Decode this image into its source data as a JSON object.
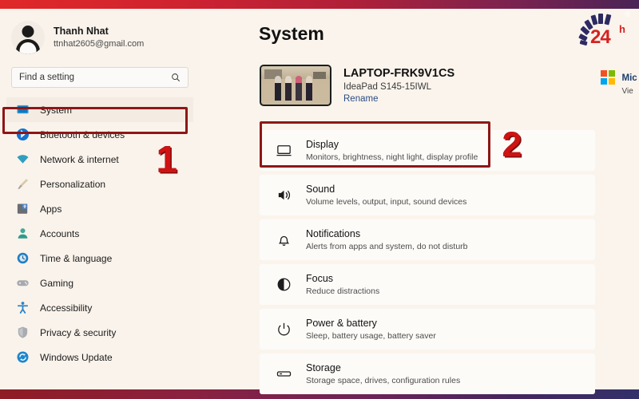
{
  "window": {
    "frame_top_color": "#cf2330",
    "frame_bottom_color": "#46265e",
    "background": "#faf4ec"
  },
  "watermark": {
    "brand": "24",
    "superscript": "h",
    "registered": "®",
    "arc_color": "#2d2a63",
    "text_color": "#d62121"
  },
  "sidebar": {
    "account": {
      "name": "Thanh Nhat",
      "email": "ttnhat2605@gmail.com",
      "avatar_icon": "person-avatar"
    },
    "search": {
      "placeholder": "Find a setting",
      "value": "",
      "icon": "search-icon"
    },
    "items": [
      {
        "label": "System",
        "icon": "monitor-icon",
        "selected": true
      },
      {
        "label": "Bluetooth & devices",
        "icon": "bluetooth-icon",
        "selected": false
      },
      {
        "label": "Network & internet",
        "icon": "wifi-icon",
        "selected": false
      },
      {
        "label": "Personalization",
        "icon": "paintbrush-icon",
        "selected": false
      },
      {
        "label": "Apps",
        "icon": "apps-icon",
        "selected": false
      },
      {
        "label": "Accounts",
        "icon": "person-icon",
        "selected": false
      },
      {
        "label": "Time & language",
        "icon": "clock-icon",
        "selected": false
      },
      {
        "label": "Gaming",
        "icon": "gamepad-icon",
        "selected": false
      },
      {
        "label": "Accessibility",
        "icon": "accessibility-icon",
        "selected": false
      },
      {
        "label": "Privacy & security",
        "icon": "shield-icon",
        "selected": false
      },
      {
        "label": "Windows Update",
        "icon": "refresh-icon",
        "selected": false
      }
    ]
  },
  "main": {
    "title": "System",
    "device": {
      "name": "LAPTOP-FRK9V1CS",
      "model": "IdeaPad S145-15IWL",
      "rename_label": "Rename",
      "thumbnail_icon": "device-photo"
    },
    "rows": [
      {
        "title": "Display",
        "sub": "Monitors, brightness, night light, display profile",
        "icon": "monitor-icon"
      },
      {
        "title": "Sound",
        "sub": "Volume levels, output, input, sound devices",
        "icon": "speaker-icon"
      },
      {
        "title": "Notifications",
        "sub": "Alerts from apps and system, do not disturb",
        "icon": "bell-icon"
      },
      {
        "title": "Focus",
        "sub": "Reduce distractions",
        "icon": "focus-icon"
      },
      {
        "title": "Power & battery",
        "sub": "Sleep, battery usage, battery saver",
        "icon": "power-icon"
      },
      {
        "title": "Storage",
        "sub": "Storage space, drives, configuration rules",
        "icon": "storage-icon"
      }
    ]
  },
  "right_panel": {
    "title": "Mic",
    "sub": "Vie",
    "logo_icon": "microsoft-logo"
  },
  "annotations": {
    "step_one": "1",
    "step_two": "2",
    "highlight_color": "#8e1616",
    "number_color": "#d01212"
  }
}
